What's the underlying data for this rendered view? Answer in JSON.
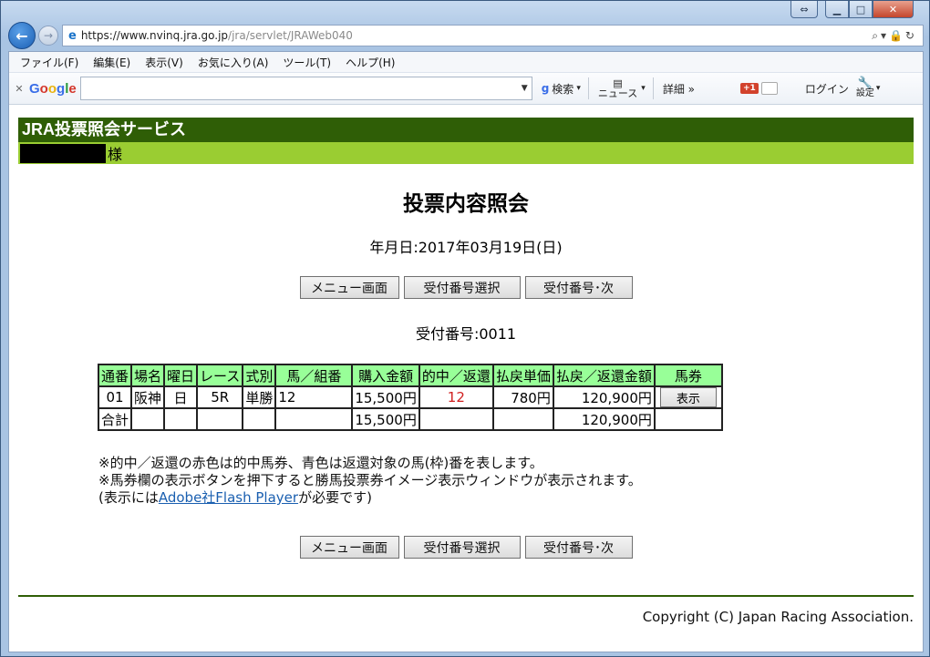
{
  "browser": {
    "url_host": "https://www.nvinq.jra.go.jp",
    "url_path": "/jra/servlet/JRAWeb040",
    "menu": [
      "ファイル(F)",
      "編集(E)",
      "表示(V)",
      "お気に入り(A)",
      "ツール(T)",
      "ヘルプ(H)"
    ],
    "google": {
      "search_label": "検索",
      "news_label": "ニュース",
      "details_label": "詳細 »",
      "gplus_label": "+1",
      "login_label": "ログイン",
      "settings_label": "設定"
    }
  },
  "site": {
    "title": "JRA投票照会サービス",
    "suffix": "様"
  },
  "page": {
    "heading": "投票内容照会",
    "date": "年月日:2017年03月19日(日)",
    "buttons": {
      "menu": "メニュー画面",
      "select": "受付番号選択",
      "next": "受付番号･次"
    },
    "receipt": "受付番号:0011"
  },
  "table": {
    "headers": [
      "通番",
      "場名",
      "曜日",
      "レース",
      "式別",
      "馬／組番",
      "購入金額",
      "的中／返還",
      "払戻単価",
      "払戻／返還金額",
      "馬券"
    ],
    "row": {
      "no": "01",
      "venue": "阪神",
      "day": "日",
      "race": "5R",
      "type": "単勝",
      "horse": "12",
      "amount": "15,500円",
      "hit": "12",
      "unit_payout": "780円",
      "payout": "120,900円",
      "ticket_button": "表示"
    },
    "total": {
      "label": "合計",
      "amount": "15,500円",
      "payout": "120,900円"
    }
  },
  "notes": {
    "line1": "※的中／返還の赤色は的中馬券、青色は返還対象の馬(枠)番を表します。",
    "line2": "※馬券欄の表示ボタンを押下すると勝馬投票券イメージ表示ウィンドウが表示されます。",
    "line3_pre": "(表示には",
    "line3_link": "Adobe社Flash Player",
    "line3_post": "が必要です)"
  },
  "footer": {
    "copyright": "Copyright (C) Japan Racing Association."
  },
  "colors": {
    "header_green": "#2f5e06",
    "sub_green": "#9acd32",
    "table_header": "#98ff98",
    "hit_red": "#d02020"
  }
}
